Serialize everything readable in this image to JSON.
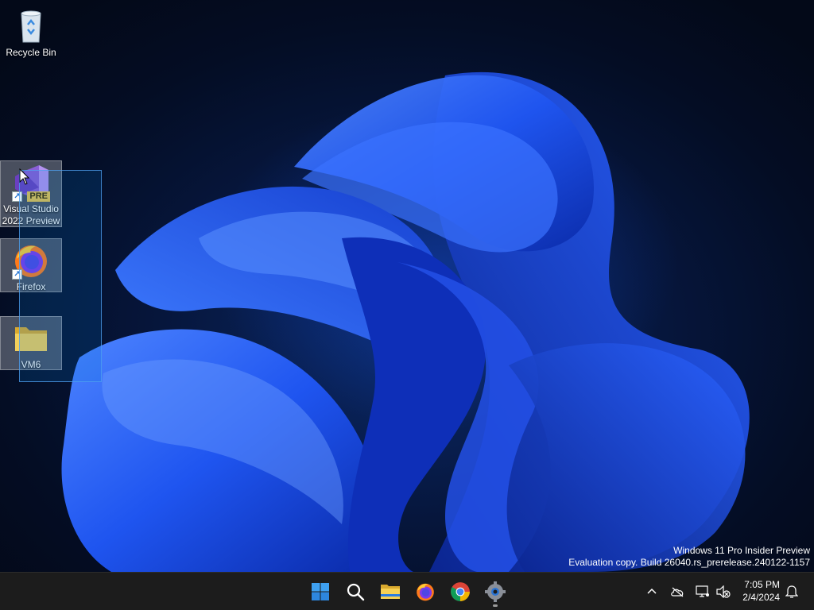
{
  "desktop": {
    "icons": [
      {
        "label": "Recycle Bin",
        "icon": "recycle-bin-icon"
      },
      {
        "label": "Visual Studio 2022 Preview",
        "icon": "visual-studio-icon",
        "badge": "PRE"
      },
      {
        "label": "Firefox",
        "icon": "firefox-icon"
      },
      {
        "label": "VM6",
        "icon": "folder-icon"
      }
    ],
    "watermark": {
      "line1": "Windows 11 Pro Insider Preview",
      "line2": "Evaluation copy. Build 26040.rs_prerelease.240122-1157"
    }
  },
  "taskbar": {
    "apps": [
      "start-icon",
      "search-icon",
      "file-explorer-icon",
      "firefox-icon",
      "chrome-icon",
      "settings-icon"
    ],
    "tray": [
      "chevron-up-icon",
      "onedrive-offline-icon",
      "network-icon",
      "volume-muted-icon",
      "notifications-icon"
    ],
    "clock": {
      "time": "7:05 PM",
      "date": "2/4/2024"
    }
  },
  "colors": {
    "accent": "#0078d4",
    "taskbar": "#1c1c1c",
    "wallpaper_bloom": "#1f55f0",
    "folder": "#e8c04a"
  }
}
